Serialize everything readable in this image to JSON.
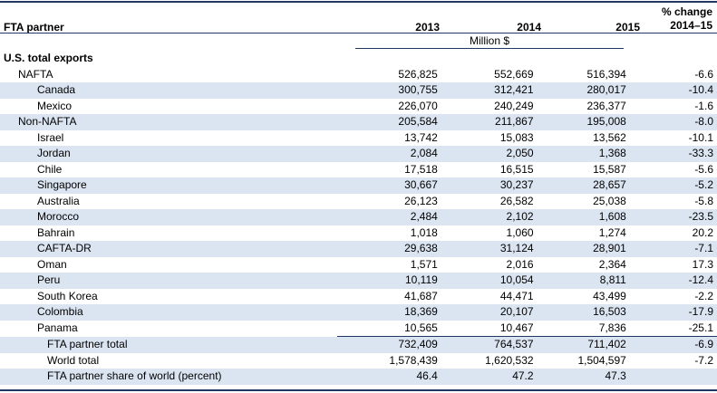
{
  "header": {
    "partner_label": "FTA partner",
    "years": [
      "2013",
      "2014",
      "2015"
    ],
    "change_label_line1": "% change",
    "change_label_line2": "2014–15",
    "units": "Million $"
  },
  "rows": [
    {
      "label": "U.S. total exports",
      "level": 0,
      "shade": false,
      "v2013": "",
      "v2014": "",
      "v2015": "",
      "pct": ""
    },
    {
      "label": "NAFTA",
      "level": 1,
      "shade": false,
      "v2013": "526,825",
      "v2014": "552,669",
      "v2015": "516,394",
      "pct": "-6.6"
    },
    {
      "label": "Canada",
      "level": 2,
      "shade": true,
      "v2013": "300,755",
      "v2014": "312,421",
      "v2015": "280,017",
      "pct": "-10.4"
    },
    {
      "label": "Mexico",
      "level": 2,
      "shade": false,
      "v2013": "226,070",
      "v2014": "240,249",
      "v2015": "236,377",
      "pct": "-1.6"
    },
    {
      "label": "Non-NAFTA",
      "level": 1,
      "shade": true,
      "v2013": "205,584",
      "v2014": "211,867",
      "v2015": "195,008",
      "pct": "-8.0"
    },
    {
      "label": "Israel",
      "level": 2,
      "shade": false,
      "v2013": "13,742",
      "v2014": "15,083",
      "v2015": "13,562",
      "pct": "-10.1"
    },
    {
      "label": "Jordan",
      "level": 2,
      "shade": true,
      "v2013": "2,084",
      "v2014": "2,050",
      "v2015": "1,368",
      "pct": "-33.3"
    },
    {
      "label": "Chile",
      "level": 2,
      "shade": false,
      "v2013": "17,518",
      "v2014": "16,515",
      "v2015": "15,587",
      "pct": "-5.6"
    },
    {
      "label": "Singapore",
      "level": 2,
      "shade": true,
      "v2013": "30,667",
      "v2014": "30,237",
      "v2015": "28,657",
      "pct": "-5.2"
    },
    {
      "label": "Australia",
      "level": 2,
      "shade": false,
      "v2013": "26,123",
      "v2014": "26,582",
      "v2015": "25,038",
      "pct": "-5.8"
    },
    {
      "label": "Morocco",
      "level": 2,
      "shade": true,
      "v2013": "2,484",
      "v2014": "2,102",
      "v2015": "1,608",
      "pct": "-23.5"
    },
    {
      "label": "Bahrain",
      "level": 2,
      "shade": false,
      "v2013": "1,018",
      "v2014": "1,060",
      "v2015": "1,274",
      "pct": "20.2"
    },
    {
      "label": "CAFTA-DR",
      "level": 2,
      "shade": true,
      "v2013": "29,638",
      "v2014": "31,124",
      "v2015": "28,901",
      "pct": "-7.1"
    },
    {
      "label": "Oman",
      "level": 2,
      "shade": false,
      "v2013": "1,571",
      "v2014": "2,016",
      "v2015": "2,364",
      "pct": "17.3"
    },
    {
      "label": "Peru",
      "level": 2,
      "shade": true,
      "v2013": "10,119",
      "v2014": "10,054",
      "v2015": "8,811",
      "pct": "-12.4"
    },
    {
      "label": "South Korea",
      "level": 2,
      "shade": false,
      "v2013": "41,687",
      "v2014": "44,471",
      "v2015": "43,499",
      "pct": "-2.2"
    },
    {
      "label": "Colombia",
      "level": 2,
      "shade": true,
      "v2013": "18,369",
      "v2014": "20,107",
      "v2015": "16,503",
      "pct": "-17.9"
    },
    {
      "label": "Panama",
      "level": 2,
      "shade": false,
      "v2013": "10,565",
      "v2014": "10,467",
      "v2015": "7,836",
      "pct": "-25.1"
    },
    {
      "label": "FTA partner total",
      "level": 3,
      "shade": true,
      "v2013": "732,409",
      "v2014": "764,537",
      "v2015": "711,402",
      "pct": "-6.9",
      "total": true
    },
    {
      "label": "World total",
      "level": 3,
      "shade": false,
      "v2013": "1,578,439",
      "v2014": "1,620,532",
      "v2015": "1,504,597",
      "pct": "-7.2"
    },
    {
      "label": "FTA partner share of world (percent)",
      "level": 3,
      "shade": true,
      "v2013": "46.4",
      "v2014": "47.2",
      "v2015": "47.3",
      "pct": ""
    }
  ],
  "colors": {
    "rule": "#1f3864",
    "shade": "#dbe5f1"
  }
}
